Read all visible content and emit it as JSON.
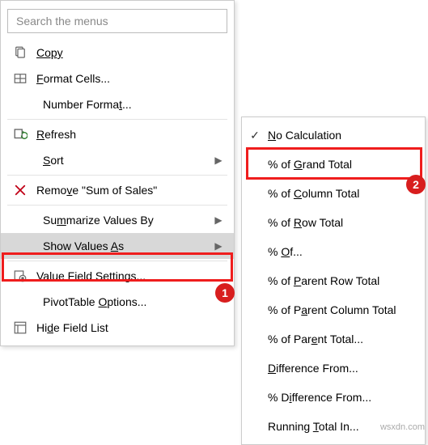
{
  "search": {
    "placeholder": "Search the menus"
  },
  "menu": {
    "copy": "Copy",
    "format_cells": "Format Cells...",
    "number_format": "Number Format...",
    "refresh": "Refresh",
    "sort": "Sort",
    "remove": "Remove \"Sum of Sales\"",
    "summarize": "Summarize Values By",
    "show_values": "Show Values As",
    "value_field_settings": "Value Field Settings...",
    "pivot_options": "PivotTable Options...",
    "hide_field_list": "Hide Field List"
  },
  "submenu": {
    "no_calculation": "No Calculation",
    "grand_total": "% of Grand Total",
    "column_total": "% of Column Total",
    "row_total": "% of Row Total",
    "of": "% Of...",
    "parent_row": "% of Parent Row Total",
    "parent_column": "% of Parent Column Total",
    "parent_total": "% of Parent Total...",
    "difference_from": "Difference From...",
    "pct_difference_from": "% Difference From...",
    "running_total": "Running Total In..."
  },
  "badges": {
    "one": "1",
    "two": "2"
  },
  "watermark": "wsxdn.com"
}
